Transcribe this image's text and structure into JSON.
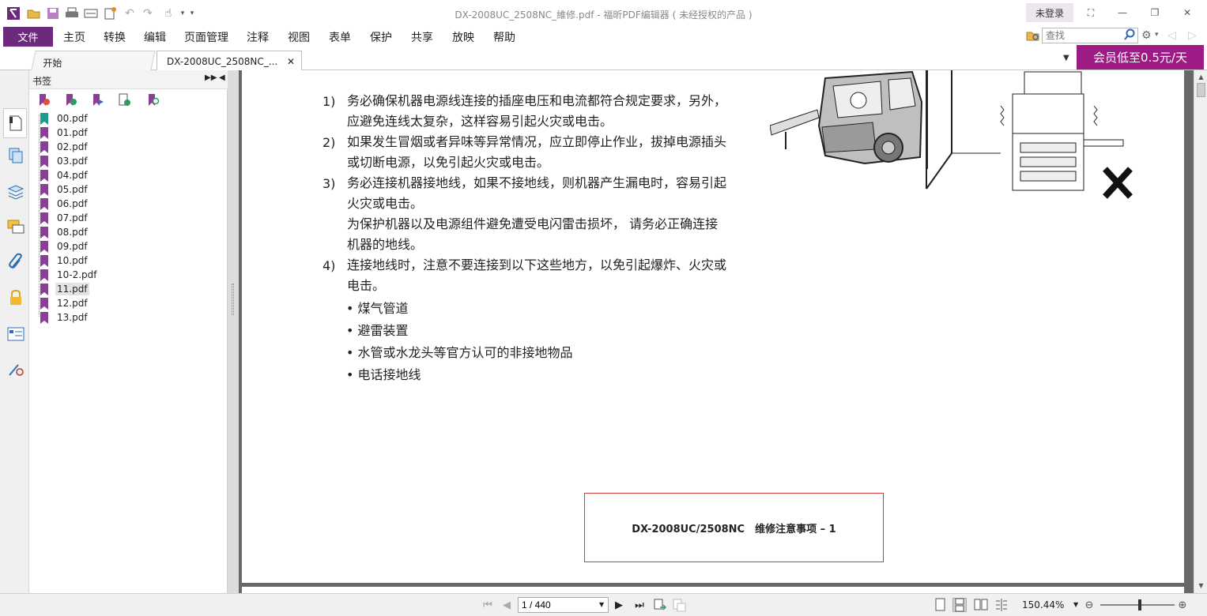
{
  "window": {
    "title": "DX-2008UC_2508NC_維修.pdf - 福昕PDF编辑器 ( 未经授权的产品 )",
    "login_label": "未登录"
  },
  "menu": {
    "file_label": "文件",
    "items": [
      "主页",
      "转换",
      "编辑",
      "页面管理",
      "注释",
      "视图",
      "表单",
      "保护",
      "共享",
      "放映",
      "帮助"
    ]
  },
  "search": {
    "placeholder": "查找"
  },
  "tabs": [
    {
      "label": "开始"
    },
    {
      "label": "DX-2008UC_2508NC_..."
    }
  ],
  "promo": {
    "label": "会员低至0.5元/天"
  },
  "bookmarks": {
    "title": "书签",
    "items": [
      "00.pdf",
      "01.pdf",
      "02.pdf",
      "03.pdf",
      "04.pdf",
      "05.pdf",
      "06.pdf",
      "07.pdf",
      "08.pdf",
      "09.pdf",
      "10.pdf",
      "10-2.pdf",
      "11.pdf",
      "12.pdf",
      "13.pdf"
    ],
    "selected": "11.pdf"
  },
  "document": {
    "items": [
      {
        "num": "1)",
        "text": "务必确保机器电源线连接的插座电压和电流都符合规定要求，另外，应避免连线太复杂，这样容易引起火灾或电击。"
      },
      {
        "num": "2)",
        "text": "如果发生冒烟或者异味等异常情况，应立即停止作业，拔掉电源插头或切断电源，以免引起火灾或电击。"
      },
      {
        "num": "3)",
        "text": "务必连接机器接地线，如果不接地线，则机器产生漏电时，容易引起火灾或电击。"
      },
      {
        "num": "",
        "text": "为保护机器以及电源组件避免遭受电闪雷击损坏， 请务必正确连接机器的地线。"
      },
      {
        "num": "4)",
        "text": "连接地线时，注意不要连接到以下这些地方，以免引起爆炸、火灾或电击。"
      }
    ],
    "bullets": [
      "煤气管道",
      "避雷装置",
      "水管或水龙头等官方认可的非接地物品",
      "电话接地线"
    ],
    "footer": "DX-2008UC/2508NC　维修注意事项 – 1"
  },
  "status": {
    "page_value": "1 / 440",
    "zoom": "150.44%"
  },
  "colors": {
    "brand": "#6c2a7c",
    "promo": "#9e1b86",
    "bookmark_icon": "#8a3f96"
  }
}
